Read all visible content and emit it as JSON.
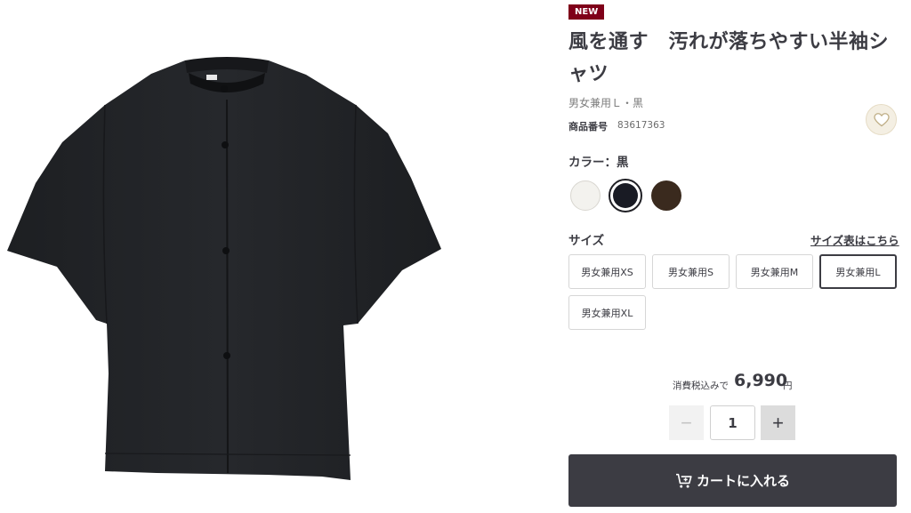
{
  "product": {
    "badge": "NEW",
    "title": "風を通す　汚れが落ちやすい半袖シャツ",
    "variant": "男女兼用Ｌ・黒",
    "product_number_label": "商品番号",
    "product_number": "83617363",
    "image_icon": "black-short-sleeve-shirt-photo",
    "favorite_icon": "heart-icon"
  },
  "color": {
    "label": "カラー：黒",
    "swatches": [
      {
        "name": "white",
        "hex": "#f3f2ee"
      },
      {
        "name": "black",
        "hex": "#191b24",
        "selected": true
      },
      {
        "name": "brown",
        "hex": "#3a2a1e"
      }
    ]
  },
  "size": {
    "label": "サイズ",
    "guide_link": "サイズ表はこちら",
    "options": [
      "男女兼用XS",
      "男女兼用S",
      "男女兼用M",
      "男女兼用L",
      "男女兼用XL"
    ],
    "selected": "男女兼用L"
  },
  "price": {
    "tax_label": "消費税込みで",
    "amount": "6,990",
    "currency": "円"
  },
  "quantity": {
    "minus": "−",
    "value": "1",
    "plus": "+"
  },
  "cart": {
    "label": "カートに入れる",
    "icon": "cart-plus-icon"
  },
  "colors": {
    "badge": "#7f0019",
    "primary": "#3c3c43",
    "favorite_bg": "#f4efe3"
  }
}
